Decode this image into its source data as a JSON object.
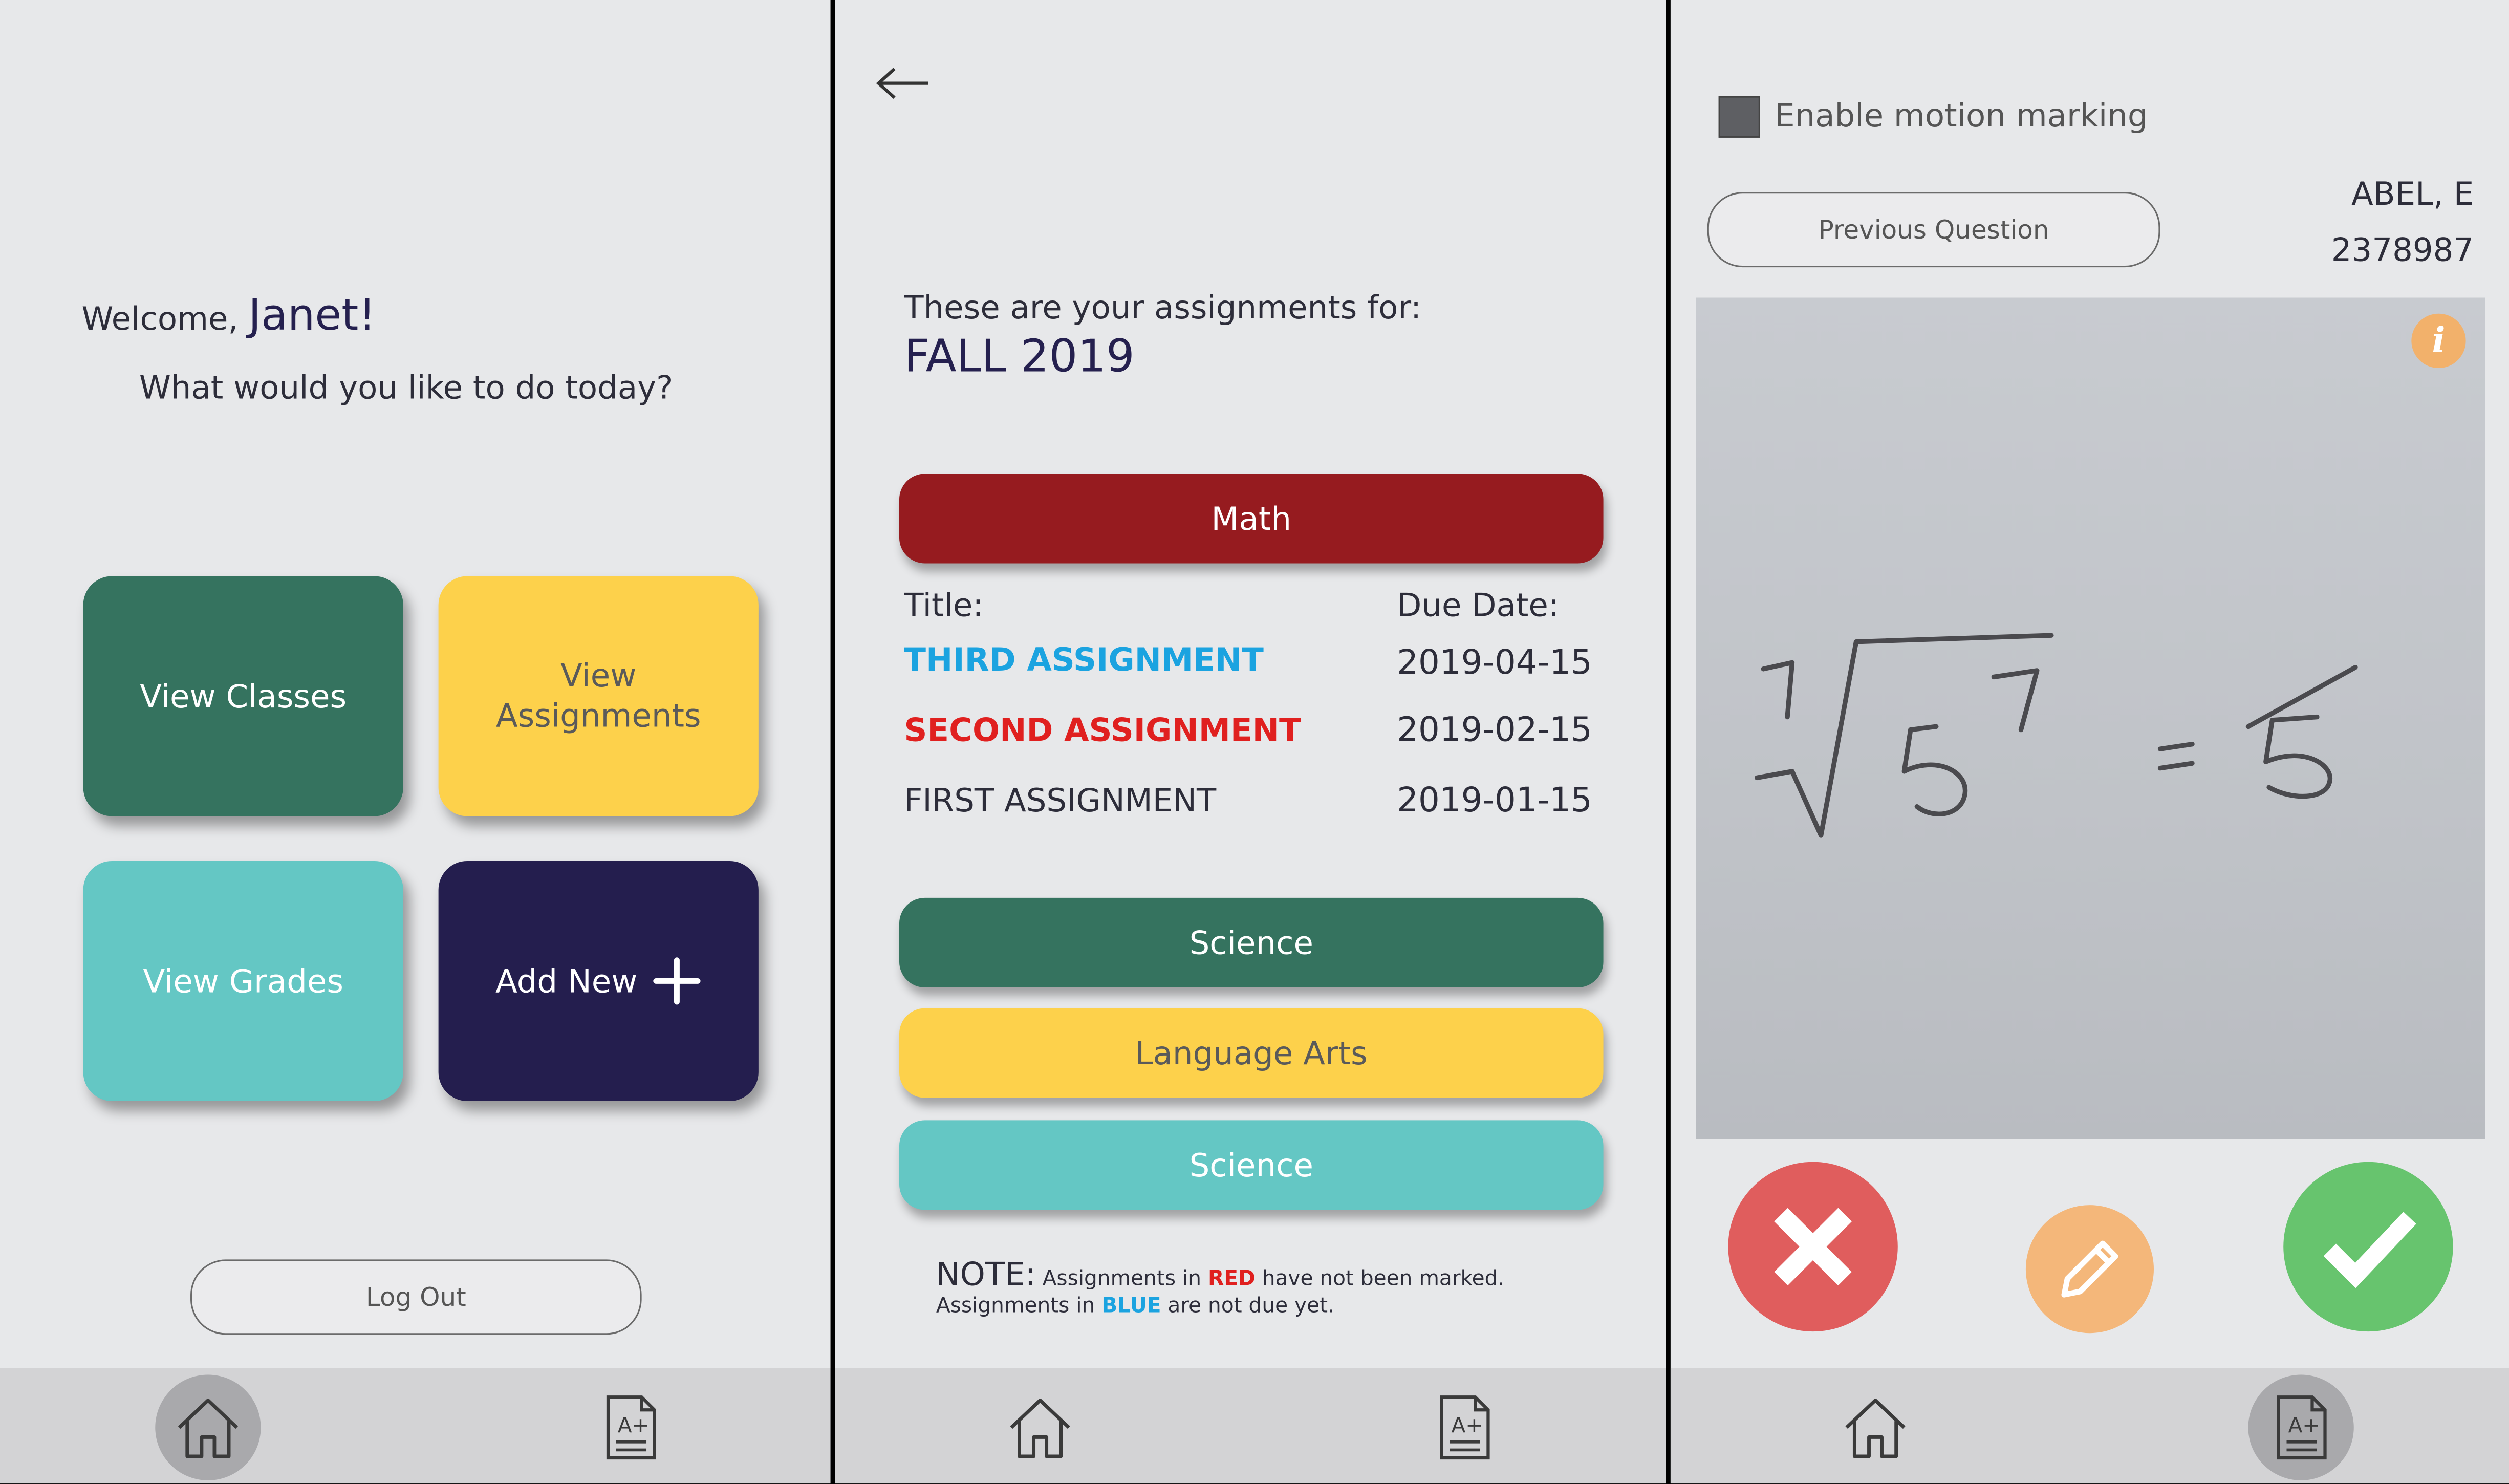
{
  "screen_home": {
    "welcome_prefix": "Welcome,",
    "user_name": "Janet!",
    "question": "What would you like to do today?",
    "tiles": [
      {
        "label": "View Classes",
        "color": "#35735f"
      },
      {
        "label": "View Assignments",
        "color": "#fdd14b"
      },
      {
        "label": "View Grades",
        "color": "#64c7c4"
      },
      {
        "label": "Add New",
        "color": "#241e4e"
      }
    ],
    "logout_label": "Log Out"
  },
  "screen_assignments": {
    "intro": "These are your assignments for:",
    "term": "FALL 2019",
    "classes": [
      {
        "label": "Math",
        "color": "#961b1f"
      },
      {
        "label": "Science",
        "color": "#35735f"
      },
      {
        "label": "Language Arts",
        "color": "#fdd14b"
      },
      {
        "label": "Science",
        "color": "#64c7c4"
      }
    ],
    "col_title": "Title:",
    "col_due": "Due Date:",
    "assignments": [
      {
        "title": "THIRD ASSIGNMENT",
        "due": "2019-04-15",
        "color": "#1ba3e0"
      },
      {
        "title": "SECOND ASSIGNMENT",
        "due": "2019-02-15",
        "color": "#e0201f"
      },
      {
        "title": "FIRST ASSIGNMENT",
        "due": "2019-01-15",
        "color": "#2d2d3a"
      }
    ],
    "note": {
      "label": "NOTE:",
      "line1_a": "Assignments in",
      "line1_red": "RED",
      "line1_b": "have not been marked.",
      "line2_a": "Assignments in",
      "line2_blue": "BLUE",
      "line2_b": "are not due yet."
    }
  },
  "screen_marking": {
    "motion_label": "Enable motion marking",
    "prev_question": "Previous Question",
    "student_name": "ABEL, E",
    "student_id": "2378987",
    "info_glyph": "i",
    "actions": {
      "reject_color": "#e05d5d",
      "edit_color": "#f4b77a",
      "accept_color": "#67c46e"
    }
  },
  "icons": [
    "home-icon",
    "report-card-icon",
    "back-arrow-icon",
    "plus-icon",
    "info-icon",
    "close-icon",
    "pencil-icon",
    "checkmark-icon"
  ]
}
